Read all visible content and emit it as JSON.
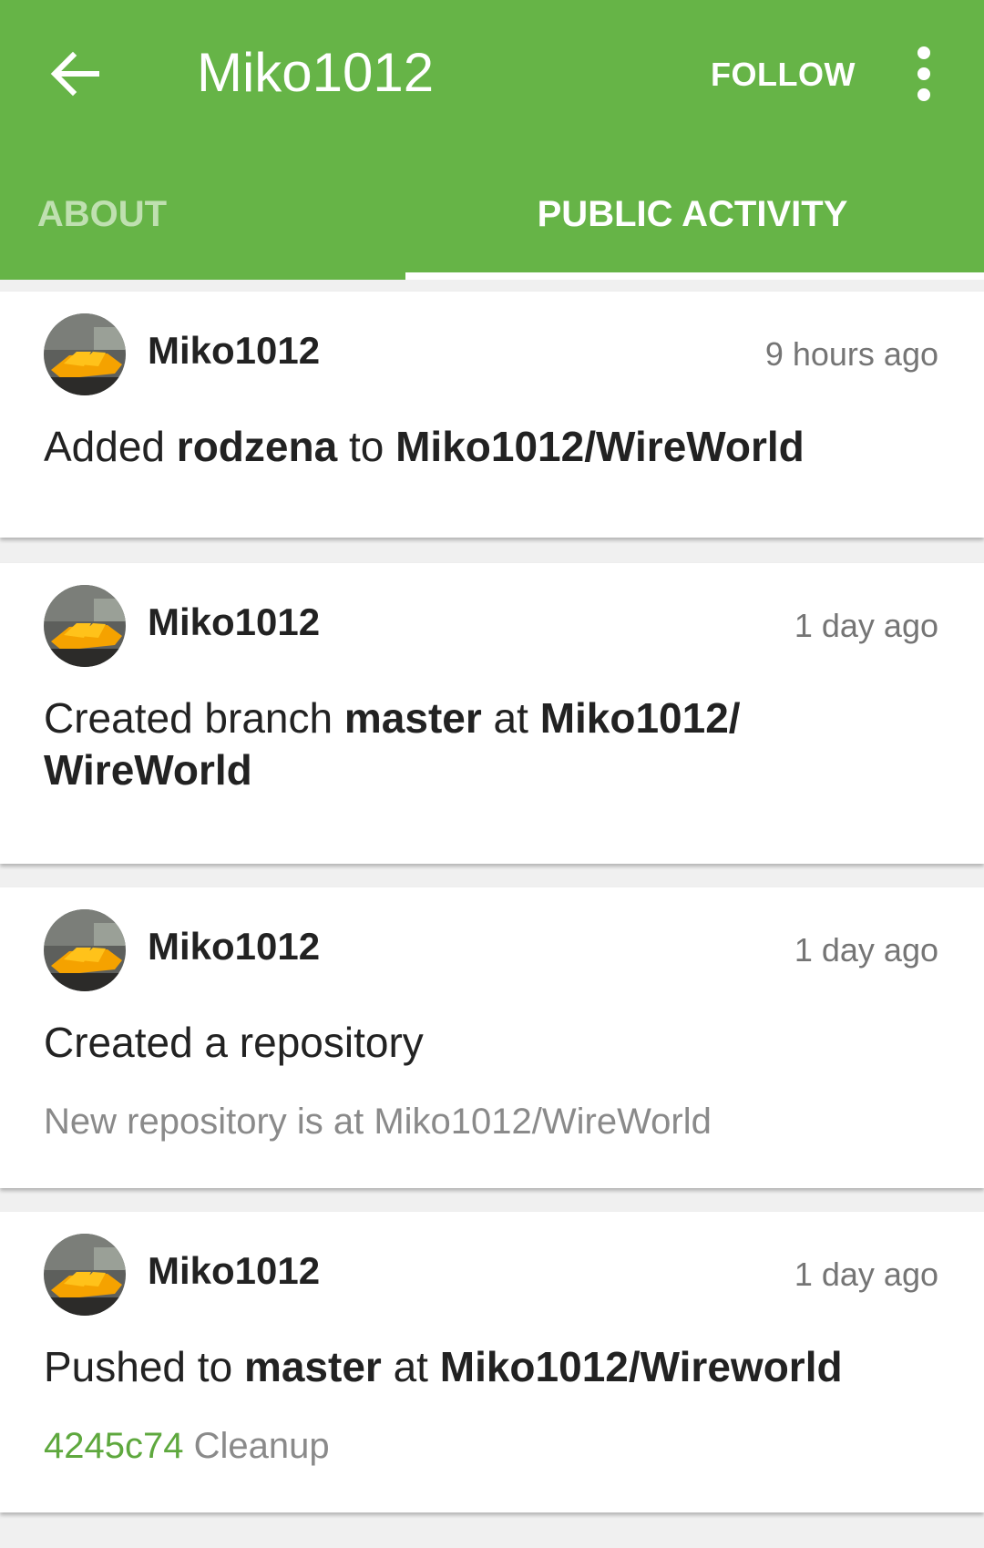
{
  "appbar": {
    "title": "Miko1012",
    "follow_label": "FOLLOW",
    "color": "#66b447",
    "back_icon": "arrow-left-icon",
    "more_icon": "more-vert-icon"
  },
  "tabs": [
    {
      "label": "ABOUT",
      "selected": false
    },
    {
      "label": "PUBLIC ACTIVITY",
      "selected": true
    }
  ],
  "events": [
    {
      "user": "Miko1012",
      "time": "9 hours ago",
      "parts": [
        "Added ",
        "rodzena",
        " to ",
        "Miko1012/WireWorld"
      ]
    },
    {
      "user": "Miko1012",
      "time": "1 day ago",
      "parts": [
        "Created branch ",
        "master",
        " at ",
        "Miko1012/",
        "WireWorld"
      ]
    },
    {
      "user": "Miko1012",
      "time": "1 day ago",
      "parts": [
        "Created a repository"
      ],
      "detail": "New repository is at Miko1012/WireWorld"
    },
    {
      "user": "Miko1012",
      "time": "1 day ago",
      "parts": [
        "Pushed to ",
        "master",
        " at ",
        "Miko1012/Wireworld"
      ],
      "commit_sha": "4245c74",
      "commit_message": " Cleanup"
    }
  ]
}
